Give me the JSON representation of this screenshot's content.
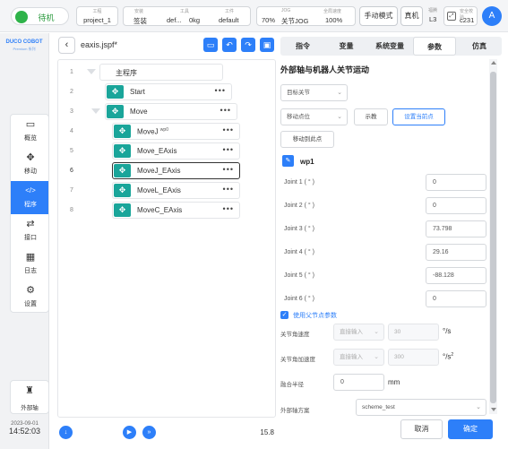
{
  "status": {
    "label": "待机"
  },
  "topbar": {
    "project": {
      "label": "工程",
      "value": "project_1"
    },
    "safety": {
      "label": "安装",
      "value": "签装"
    },
    "tool": {
      "label": "工具",
      "value": "def..."
    },
    "payload": {
      "value": "0kg"
    },
    "workpiece": {
      "label": "工件",
      "value": "default"
    },
    "jog": {
      "label": "JOG",
      "value": "70%",
      "mode": "关节JOG"
    },
    "speed": {
      "label": "全局速度",
      "value": "100%"
    },
    "manual_btn": "手动模式",
    "real_btn": "真机",
    "level": {
      "label": "福腾",
      "value": "L3"
    },
    "safety_check": {
      "label": "安全校验",
      "value": "c231"
    },
    "avatar": "A"
  },
  "logo": {
    "name": "DUCO COBOT",
    "sub": "Premium 系列"
  },
  "nav": [
    {
      "label": "概览",
      "icon": "monitor-icon",
      "glyph": "▭"
    },
    {
      "label": "移动",
      "icon": "move-icon",
      "glyph": "✥"
    },
    {
      "label": "程序",
      "icon": "code-icon",
      "glyph": "</>"
    },
    {
      "label": "接口",
      "icon": "interface-icon",
      "glyph": "⇄"
    },
    {
      "label": "日志",
      "icon": "calendar-icon",
      "glyph": "▦"
    },
    {
      "label": "设置",
      "icon": "gear-icon",
      "glyph": "⚙"
    }
  ],
  "ext_axis": {
    "label": "外部轴"
  },
  "datetime": {
    "date": "2023-09-01",
    "time": "14:52:03"
  },
  "program": {
    "filename": "eaxis.jspf*",
    "lines": [
      "1",
      "2",
      "3",
      "4",
      "5",
      "6",
      "7",
      "8"
    ],
    "root": "主程序",
    "nodes": [
      {
        "label": "Start",
        "sup": ""
      },
      {
        "label": "Move",
        "sup": ""
      },
      {
        "label": "MoveJ",
        "sup": "wp0"
      },
      {
        "label": "Move_EAxis",
        "sup": ""
      },
      {
        "label": "MoveJ_EAxis",
        "sup": ""
      },
      {
        "label": "MoveL_EAxis",
        "sup": ""
      },
      {
        "label": "MoveC_EAxis",
        "sup": ""
      }
    ],
    "version": "15.8"
  },
  "tabs": [
    "指令",
    "变量",
    "系统变量",
    "参数",
    "仿真"
  ],
  "panel": {
    "title": "外部轴与机器人关节运动",
    "target_select": "目标关节",
    "move_mode_select": "移动点位",
    "teach_btn": "示教",
    "set_current_btn": "设置当前点",
    "move_to_btn": "移动到此点",
    "waypoint": "wp1",
    "joints": [
      {
        "label": "Joint 1 ( ° )",
        "value": "0"
      },
      {
        "label": "Joint 2 ( ° )",
        "value": "0"
      },
      {
        "label": "Joint 3 ( ° )",
        "value": "73.798"
      },
      {
        "label": "Joint 4 ( ° )",
        "value": "29.16"
      },
      {
        "label": "Joint 5 ( ° )",
        "value": "-88.128"
      },
      {
        "label": "Joint 6 ( ° )",
        "value": "0"
      }
    ],
    "use_parent_param": "使用父节点参数",
    "joint_speed": {
      "label": "关节角速度",
      "mode": "直接输入",
      "value": "30",
      "unit": "°/s"
    },
    "joint_accel": {
      "label": "关节角加速度",
      "mode": "直接输入",
      "value": "300",
      "unit": "°/s",
      "unit_sup": "2"
    },
    "blend_radius": {
      "label": "融合半径",
      "value": "0",
      "unit": "mm"
    },
    "ext_scheme": {
      "label": "外部轴方案",
      "value": "scheme_test"
    }
  },
  "footer": {
    "cancel": "取消",
    "confirm": "确定"
  }
}
